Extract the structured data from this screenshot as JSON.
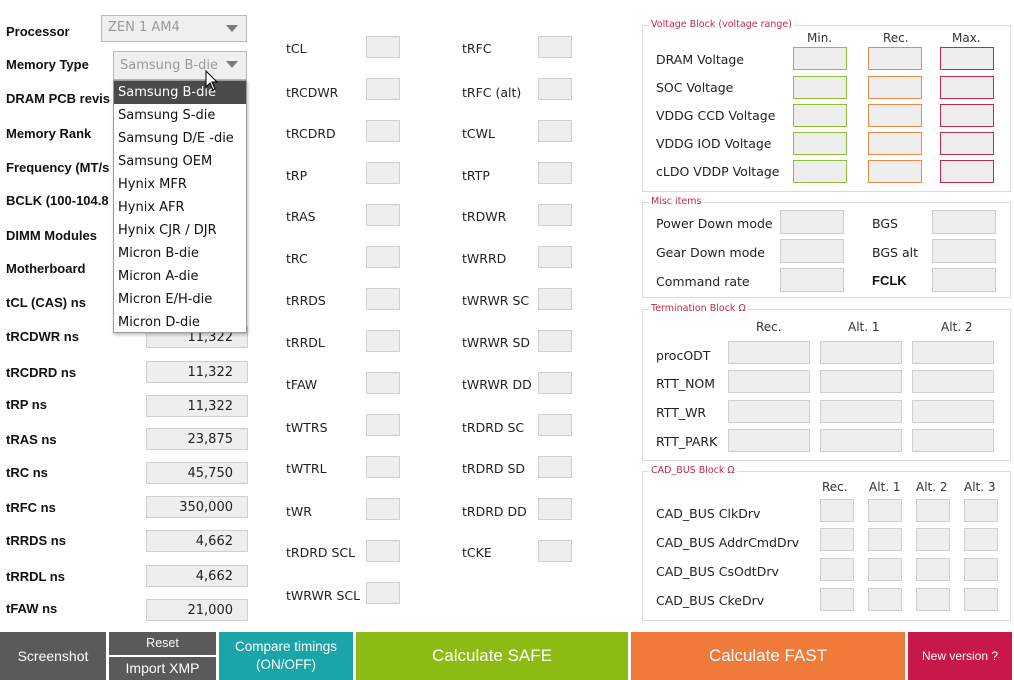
{
  "left_labels": {
    "processor": "Processor",
    "memory_type": "Memory Type",
    "dram_pcb": "DRAM PCB revis",
    "memory_rank": "Memory Rank",
    "frequency": "Frequency (MT/s",
    "bclk": "BCLK (100-104.8",
    "dimm_modules": "DIMM Modules",
    "motherboard": "Motherboard",
    "tcl": "tCL (CAS) ns",
    "trcdwr": "tRCDWR ns",
    "trcdrd": "tRCDRD ns",
    "trp": "tRP ns",
    "tras": "tRAS ns",
    "trc": "tRC ns",
    "trfc": "tRFC ns",
    "trrds": "tRRDS ns",
    "trrdl": "tRRDL ns",
    "tfaw": "tFAW ns"
  },
  "processor_value": "ZEN 1 AM4",
  "memory_type_value": "Samsung B-die",
  "ns_values": {
    "trcdwr": "11,322",
    "trcdrd": "11,322",
    "trp": "11,322",
    "tras": "23,875",
    "trc": "45,750",
    "trfc": "350,000",
    "trrds": "4,662",
    "trrdl": "4,662",
    "tfaw": "21,000"
  },
  "dropdown_options": [
    "Samsung B-die",
    "Samsung S-die",
    "Samsung D/E -die",
    "Samsung OEM",
    "Hynix MFR",
    "Hynix AFR",
    "Hynix CJR / DJR",
    "Micron B-die",
    "Micron A-die",
    "Micron E/H-die",
    "Micron D-die"
  ],
  "timings_col1": [
    "tCL",
    "tRCDWR",
    "tRCDRD",
    "tRP",
    "tRAS",
    "tRC",
    "tRRDS",
    "tRRDL",
    "tFAW",
    "tWTRS",
    "tWTRL",
    "tWR",
    "tRDRD SCL",
    "tWRWR SCL"
  ],
  "timings_col2": [
    "tRFC",
    "tRFC (alt)",
    "tCWL",
    "tRTP",
    "tRDWR",
    "tWRRD",
    "tWRWR SC",
    "tWRWR SD",
    "tWRWR DD",
    "tRDRD SC",
    "tRDRD SD",
    "tRDRD DD",
    "tCKE"
  ],
  "voltage_block": {
    "title": "Voltage Block (voltage range)",
    "col_min": "Min.",
    "col_rec": "Rec.",
    "col_max": "Max.",
    "rows": [
      "DRAM Voltage",
      "SOC Voltage",
      "VDDG  CCD Voltage",
      "VDDG  IOD Voltage",
      "cLDO VDDP Voltage"
    ],
    "min_color": "#8fbe3c",
    "rec_color": "#e88a4a",
    "max_color": "#c0294b"
  },
  "misc_block": {
    "title": "Misc items",
    "power_down": "Power Down mode",
    "gear_down": "Gear Down mode",
    "command_rate": "Command rate",
    "bgs": "BGS",
    "bgs_alt": "BGS alt",
    "fclk": "FCLK"
  },
  "termination_block": {
    "title": "Termination Block Ω",
    "col_rec": "Rec.",
    "col_alt1": "Alt. 1",
    "col_alt2": "Alt. 2",
    "rows": [
      "procODT",
      "RTT_NOM",
      "RTT_WR",
      "RTT_PARK"
    ]
  },
  "cadbus_block": {
    "title": "CAD_BUS Block Ω",
    "col_rec": "Rec.",
    "col_alt1": "Alt. 1",
    "col_alt2": "Alt. 2",
    "col_alt3": "Alt. 3",
    "rows": [
      "CAD_BUS ClkDrv",
      "CAD_BUS AddrCmdDrv",
      "CAD_BUS CsOdtDrv",
      "CAD_BUS CkeDrv"
    ]
  },
  "buttons": {
    "screenshot": "Screenshot",
    "reset": "Reset",
    "import_xmp": "Import XMP",
    "compare_line1": "Compare timings",
    "compare_line2": "(ON/OFF)",
    "calc_safe": "Calculate SAFE",
    "calc_fast": "Calculate FAST",
    "new_version": "New version ?"
  },
  "colors": {
    "screenshot_bg": "#5a5a5a",
    "reset_bg": "#5a5a5a",
    "compare_bg": "#1aa5a8",
    "safe_bg": "#8cbc14",
    "fast_bg": "#f07a3a",
    "new_version_bg": "#c8184a"
  }
}
